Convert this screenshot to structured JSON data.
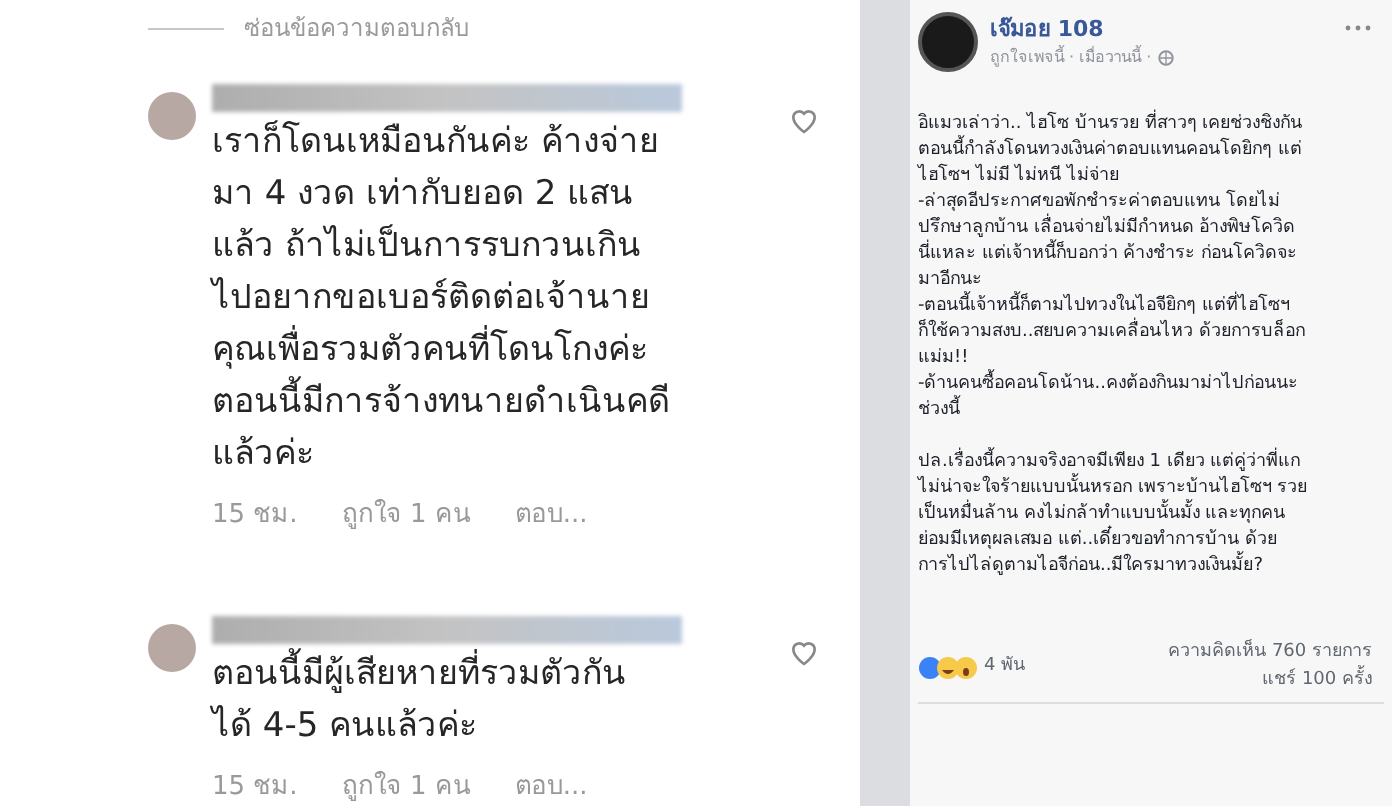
{
  "instagram": {
    "hide_replies": "ซ่อนข้อความตอบกลับ",
    "comments": [
      {
        "lines": [
          "เราก็โดนเหมือนกันค่ะ ค้างจ่าย",
          "มา 4 งวด เท่ากับยอด 2 แสน",
          "แล้ว ถ้าไม่เป็นการรบกวนเกิน",
          "ไปอยากขอเบอร์ติดต่อเจ้านาย",
          "คุณเพื่อรวมตัวคนที่โดนโกงค่ะ",
          "ตอนนี้มีการจ้างทนายดำเนินคดี",
          "แล้วค่ะ"
        ],
        "time": "15 ชม.",
        "likes": "ถูกใจ 1 คน",
        "reply": "ตอบ..."
      },
      {
        "lines": [
          "ตอนนี้มีผู้เสียหายที่รวมตัวกัน",
          "ได้ 4-5 คนแล้วค่ะ"
        ],
        "time": "15 ชม.",
        "likes": "ถูกใจ 1 คน",
        "reply": "ตอบ..."
      }
    ]
  },
  "facebook_post": {
    "page_name": "เจ๊มอย 108",
    "meta": "ถูกใจเพจนี้ · เมื่อวานนี้ ·",
    "paragraphs": [
      [
        "อิแมวเล่าว่า.. ไฮโซ บ้านรวย ที่สาวๆ เคยช่วงชิงกัน",
        "ตอนนี้กำลังโดนทวงเงินค่าตอบแทนคอนโดยิกๆ แต่",
        "ไฮโซฯ ไม่มี ไม่หนี ไม่จ่าย",
        "-ล่าสุดอีประกาศขอพักชำระค่าตอบแทน โดยไม่",
        "ปรึกษาลูกบ้าน เลื่อนจ่ายไม่มีกำหนด อ้างพิษโควิด",
        "นี่แหละ แต่เจ้าหนี้ก็บอกว่า ค้างชำระ ก่อนโควิดจะ",
        "มาอีกนะ",
        "-ตอนนี้เจ้าหนี้ก็ตามไปทวงในไอจียิกๆ แต่ที่ไฮโซฯ",
        "ก็ใช้ความสงบ..สยบความเคลื่อนไหว ด้วยการบล็อก",
        "แม่ม!!",
        "-ด้านคนซื้อคอนโดน้าน..คงต้องกินมาม่าไปก่อนนะ",
        "ช่วงนี้"
      ],
      [
        "ปล.เรื่องนี้ความจริงอาจมีเพียง 1 เดียว แต่คู่ว่าพี่แก",
        "ไม่น่าจะใจร้ายแบบนั้นหรอก เพราะบ้านไฮโซฯ รวย",
        "เป็นหมื่นล้าน คงไม่กล้าทำแบบนั้นมั้ง และทุกคน",
        "ย่อมมีเหตุผลเสมอ แต่..เดี๋ยวขอทำการบ้าน ด้วย",
        "การไปไล่ดูตามไอจีก่อน..มีใครมาทวงเงินมั้ย?"
      ]
    ],
    "reactions_count": "4 พัน",
    "comments_count": "ความคิดเห็น 760 รายการ",
    "shares_count": "แชร์ 100 ครั้ง"
  }
}
